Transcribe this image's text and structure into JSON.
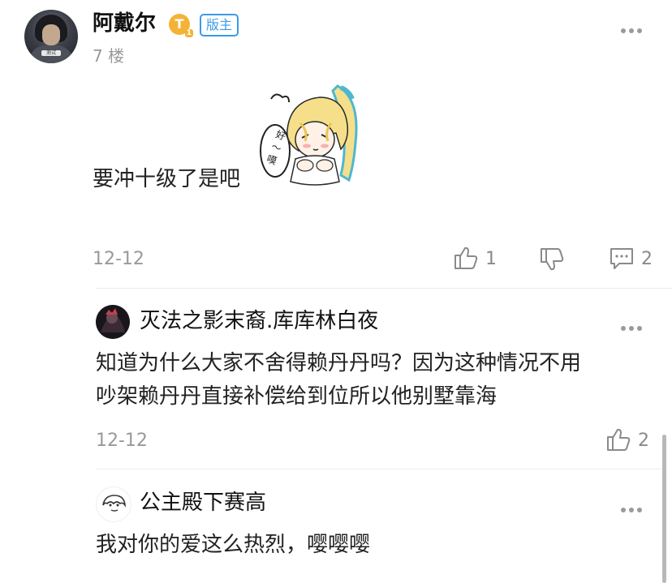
{
  "post": {
    "username": "阿戴尔",
    "level_badge": "T",
    "level_sub": "1",
    "mod_badge": "版主",
    "floor": "7 楼",
    "content": "要冲十级了是吧",
    "sticker_text": "好～嗼～",
    "date": "12-12",
    "like_count": "1",
    "comment_count": "2",
    "avatar_tag": "测试"
  },
  "replies": [
    {
      "username": "灭法之影末裔.库库林白夜",
      "content_line1": "知道为什么大家不舍得赖丹丹吗？因为这种情况不用",
      "content_line2": "吵架赖丹丹直接补偿给到位所以他别墅靠海",
      "date": "12-12",
      "like_count": "2"
    },
    {
      "username": "公主殿下赛高",
      "content_line1": "我对你的爱这么热烈，嘤嘤嘤"
    }
  ],
  "icons": {
    "like": "thumbs-up-icon",
    "dislike": "thumbs-down-icon",
    "comment": "comment-icon",
    "more": "more-icon"
  },
  "colors": {
    "mod_badge": "#3b9be6",
    "level_badge": "#f3b435",
    "meta_text": "#999999"
  }
}
